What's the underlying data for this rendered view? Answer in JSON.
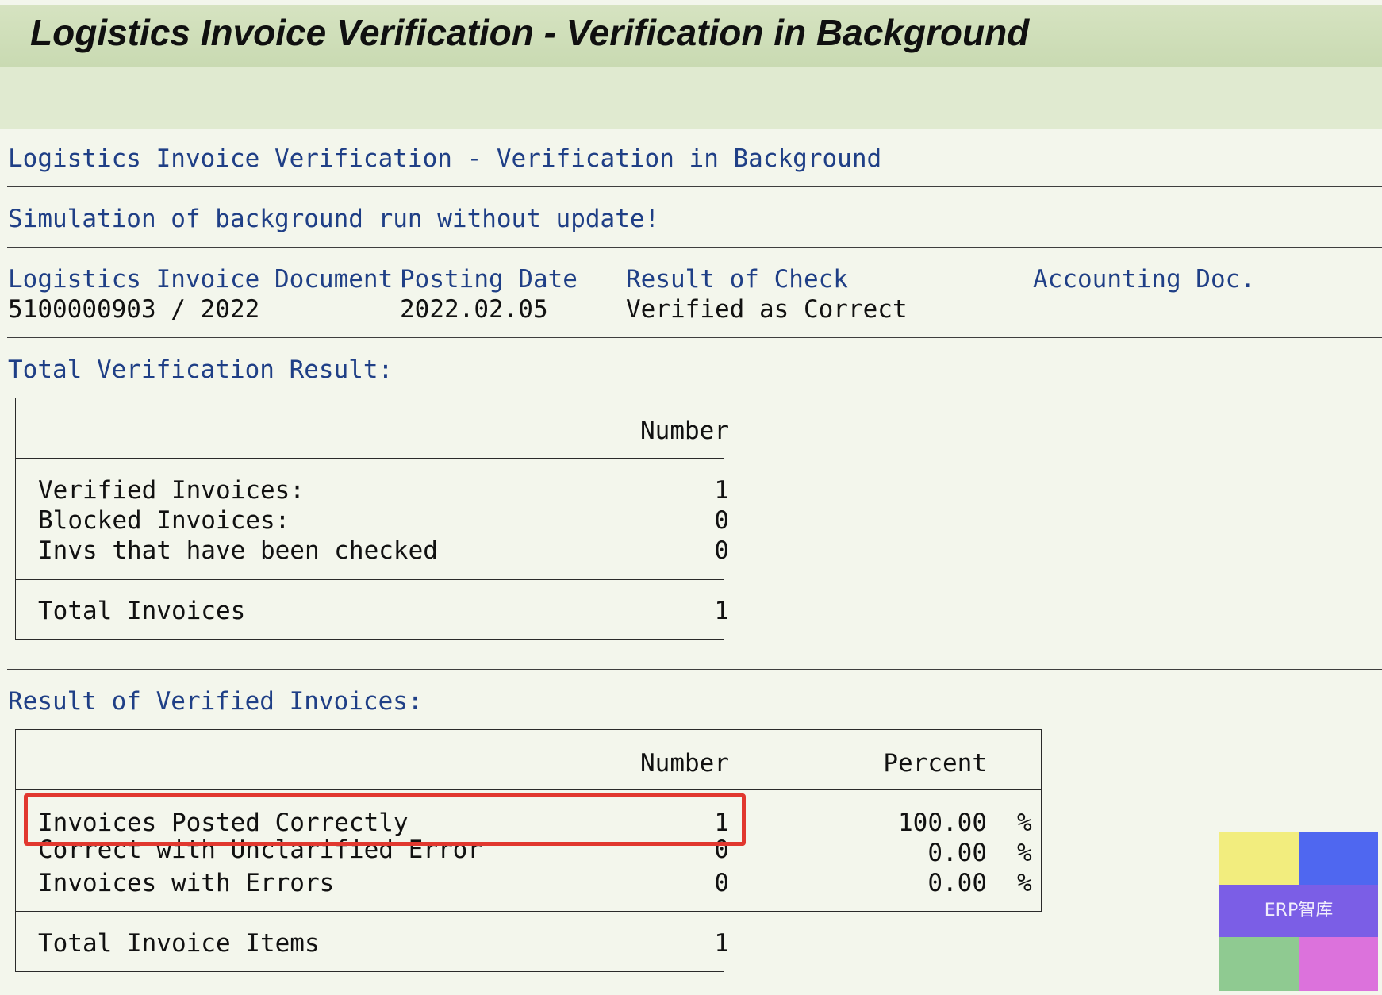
{
  "window": {
    "title": "Logistics Invoice Verification - Verification in Background"
  },
  "report": {
    "heading": "Logistics Invoice Verification - Verification in Background",
    "simulation_note": "Simulation of background run without update!",
    "columns": {
      "document": "Logistics Invoice Document",
      "posting_date": "Posting Date",
      "result": "Result of Check",
      "accounting": "Accounting Doc."
    },
    "row": {
      "document": "5100000903 / 2022",
      "posting_date": "2022.02.05",
      "result": "Verified as Correct",
      "accounting": ""
    }
  },
  "total_result": {
    "heading": "Total Verification Result:",
    "number_header": "Number",
    "rows": [
      {
        "label": "Verified Invoices:",
        "value": "1"
      },
      {
        "label": "Blocked Invoices:",
        "value": "0"
      },
      {
        "label": "Invs that have been checked",
        "value": "0"
      }
    ],
    "total": {
      "label": "Total Invoices",
      "value": "1"
    }
  },
  "verified_result": {
    "heading": "Result of Verified Invoices:",
    "number_header": "Number",
    "percent_header": "Percent",
    "rows": [
      {
        "label": "Invoices Posted Correctly",
        "value": "1",
        "percent": "100.00",
        "unit": "%"
      },
      {
        "label": "Correct with Unclarified Error",
        "value": "0",
        "percent": "0.00",
        "unit": "%"
      },
      {
        "label": "Invoices with Errors",
        "value": "0",
        "percent": "0.00",
        "unit": "%"
      }
    ],
    "total": {
      "label": "Total Invoice Items",
      "value": "1"
    }
  },
  "watermark": {
    "text": "ERP智库",
    "colors": {
      "yellow": "#f2ed7e",
      "blue": "#4f67f0",
      "purple": "#7b5ee6",
      "green": "#8fca91",
      "pink": "#dc72dc"
    }
  },
  "highlight": {
    "color": "#e1382f"
  }
}
